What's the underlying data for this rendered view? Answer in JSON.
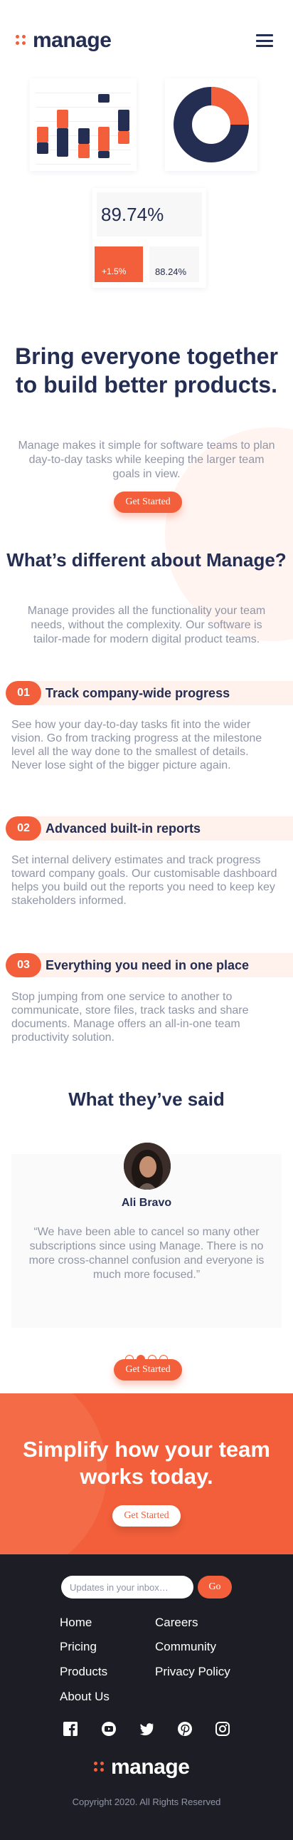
{
  "header": {
    "logo_text": "manage"
  },
  "illustration": {
    "stat_value": "89.74%",
    "stat_change": "+1.5%",
    "stat_secondary": "88.24%",
    "donut_fill": 0.75
  },
  "hero": {
    "title": "Bring everyone together to build better products.",
    "text": "Manage makes it simple for software teams to plan day-to-day tasks while keeping the larger team goals in view.",
    "cta_label": "Get Started"
  },
  "different": {
    "title": "What’s different about Manage?",
    "text": "Manage provides all the functionality your team needs, without the complexity. Our software is tailor-made for modern digital product teams.",
    "features": [
      {
        "num": "01",
        "title": "Track company-wide progress",
        "text": "See how your day-to-day tasks fit into the wider vision. Go from tracking progress at the milestone level all the way done to the smallest of details. Never lose sight of the bigger picture again."
      },
      {
        "num": "02",
        "title": "Advanced built-in reports",
        "text": "Set internal delivery estimates and track progress toward company goals. Our customisable dashboard helps you build out the reports you need to keep key stakeholders informed."
      },
      {
        "num": "03",
        "title": "Everything you need in one place",
        "text": "Stop jumping from one service to another to communicate, store files, track tasks and share documents. Manage offers an all-in-one team productivity solution."
      }
    ]
  },
  "testimonials": {
    "title": "What they’ve said",
    "name": "Ali Bravo",
    "quote": "“We have been able to cancel so many other subscriptions since using Manage. There is no more cross-channel confusion and everyone is much more focused.”",
    "active_dot": 2,
    "cta_label": "Get Started"
  },
  "cta": {
    "title": "Simplify how your team works today.",
    "button_label": "Get Started"
  },
  "footer": {
    "input_placeholder": "Updates in your inbox…",
    "go_label": "Go",
    "links_left": [
      "Home",
      "Pricing",
      "Products",
      "About Us"
    ],
    "links_right": [
      "Careers",
      "Community",
      "Privacy Policy"
    ],
    "socials": [
      "facebook-icon",
      "youtube-icon",
      "twitter-icon",
      "pinterest-icon",
      "instagram-icon"
    ],
    "logo_text": "manage",
    "copyright": "Copyright 2020. All Rights Reserved"
  },
  "colors": {
    "accent": "#f25f3a",
    "navy": "#242d52",
    "footer_bg": "#1d1e25",
    "text_gray": "#9095a7"
  }
}
